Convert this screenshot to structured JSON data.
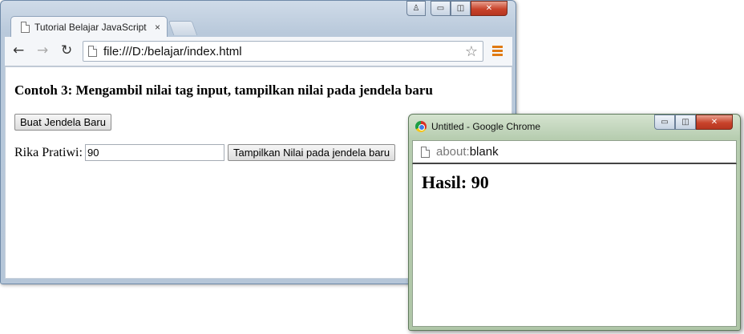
{
  "main_window": {
    "tab": {
      "title": "Tutorial Belajar JavaScript",
      "close_glyph": "×"
    },
    "caption": {
      "user": "♙",
      "minimize": "▭",
      "maximize": "◫",
      "close": "✕"
    },
    "toolbar": {
      "back": "←",
      "forward": "→",
      "reload": "↻",
      "url": "file:///D:/belajar/index.html",
      "star": "☆"
    },
    "page": {
      "heading": "Contoh 3: Mengambil nilai tag input, tampilkan nilai pada jendela baru",
      "open_window_button": "Buat Jendela Baru",
      "input_label": "Rika Pratiwi:",
      "input_value": "90",
      "show_value_button": "Tampilkan Nilai pada jendela baru"
    }
  },
  "popup_window": {
    "title": "Untitled - Google Chrome",
    "caption": {
      "minimize": "▭",
      "maximize": "◫",
      "close": "✕"
    },
    "address_scheme": "about:",
    "address_host": "blank",
    "result_heading": "Hasil: 90"
  },
  "colors": {
    "menu_accent": "#e07a12",
    "close_button": "#c8432b"
  }
}
